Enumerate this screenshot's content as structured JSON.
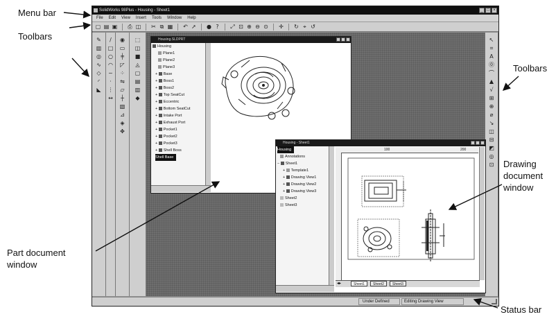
{
  "callouts": {
    "menu_bar": "Menu bar",
    "toolbars_left": "Toolbars",
    "toolbars_right": "Toolbars",
    "part_window": "Part document\nwindow",
    "drawing_window": "Drawing\ndocument\nwindow",
    "status_bar": "Status bar"
  },
  "app": {
    "title": "SolidWorks 98Plus - Housing - Sheet1",
    "menu": [
      "File",
      "Edit",
      "View",
      "Insert",
      "Tools",
      "Window",
      "Help"
    ],
    "status": {
      "left": "Under Defined",
      "right": "Editing Drawing View"
    }
  },
  "part_window": {
    "title": "Housing.SLDPRT",
    "tree": [
      "Housing",
      "Plane1",
      "Plane2",
      "Plane3",
      "Base",
      "Boss1",
      "Boss2",
      "Top SeatCut",
      "Eccentric",
      "Bottom SeatCut",
      "Intake Port",
      "Exhaust Port",
      "Pocket1",
      "Pocket2",
      "Pocket3",
      "Shell Boss",
      "Shell Base"
    ],
    "selected": "Shell Base"
  },
  "drawing_window": {
    "title": "Housing - Sheet1",
    "tree": [
      "Housing",
      "Annotations",
      "Sheet1",
      "Template1",
      "Drawing View1",
      "Drawing View2",
      "Drawing View3",
      "Sheet2",
      "Sheet3"
    ],
    "selected": "Housing",
    "tabs": [
      "Sheet1",
      "Sheet2",
      "Sheet3"
    ],
    "ruler_ticks": [
      "100",
      "200"
    ]
  },
  "colors": {
    "workspace": "#6e6e6e",
    "titlebar": "#101010",
    "panel": "#cfcfcf"
  }
}
